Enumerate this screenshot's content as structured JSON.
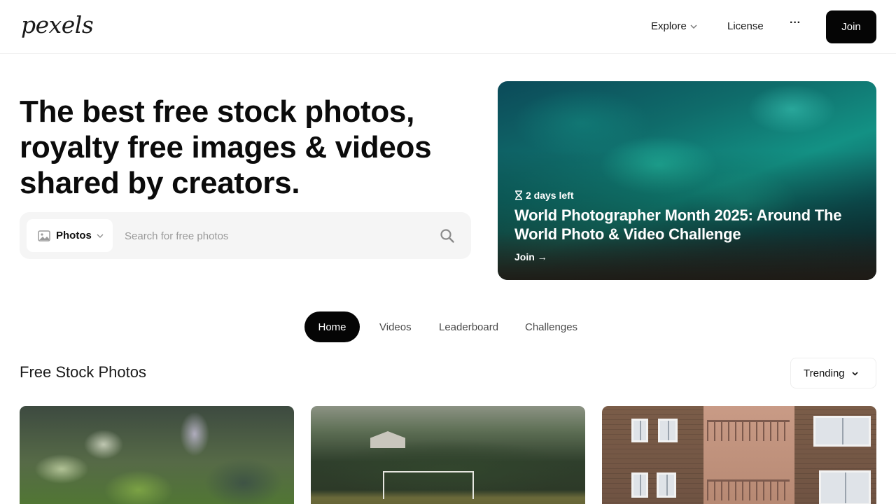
{
  "header": {
    "logo": "pexels",
    "nav": {
      "explore": "Explore",
      "license": "License",
      "more": "···"
    },
    "join_label": "Join"
  },
  "hero": {
    "title": "The best free stock photos, royalty free images & videos shared by creators.",
    "search": {
      "type_label": "Photos",
      "placeholder": "Search for free photos"
    }
  },
  "challenge": {
    "time_left": "2 days left",
    "title": "World Photographer Month 2025: Around The World Photo & Video Challenge",
    "cta": "Join →"
  },
  "tabs": [
    {
      "label": "Home",
      "active": true
    },
    {
      "label": "Videos",
      "active": false
    },
    {
      "label": "Leaderboard",
      "active": false
    },
    {
      "label": "Challenges",
      "active": false
    }
  ],
  "section": {
    "title": "Free Stock Photos",
    "sort_label": "Trending"
  },
  "colors": {
    "primary": "#050505",
    "search_bg": "#f5f5f5",
    "muted_text": "#4a4a4a",
    "placeholder": "#9a9a9a"
  }
}
